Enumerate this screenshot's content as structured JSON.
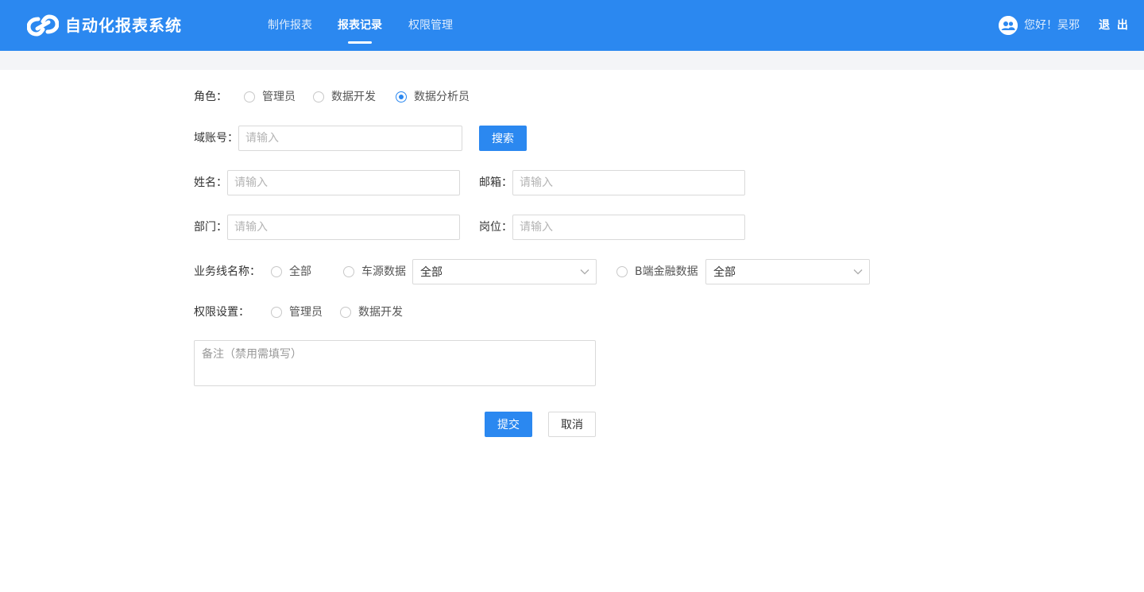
{
  "header": {
    "brand": "自动化报表系统",
    "nav": [
      "制作报表",
      "报表记录",
      "权限管理"
    ],
    "active_nav": "报表记录",
    "greeting": "您好！吴邪",
    "logout": "退 出",
    "color": "#2b88f0"
  },
  "form": {
    "role": {
      "label": "角色：",
      "options": [
        "管理员",
        "数据开发",
        "数据分析员"
      ],
      "selected": "数据分析员"
    },
    "domain_account": {
      "label": "域账号：",
      "placeholder": "请输入",
      "search_button": "搜索"
    },
    "name": {
      "label": "姓名：",
      "placeholder": "请输入"
    },
    "email": {
      "label": "邮箱：",
      "placeholder": "请输入"
    },
    "department": {
      "label": "部门：",
      "placeholder": "请输入"
    },
    "position": {
      "label": "岗位：",
      "placeholder": "请输入"
    },
    "business_line": {
      "label": "业务线名称：",
      "options": [
        "全部",
        "车源数据",
        "B端金融数据"
      ],
      "car_source_select": "全部",
      "b_finance_select": "全部"
    },
    "permission": {
      "label": "权限设置：",
      "options": [
        "管理员",
        "数据开发"
      ]
    },
    "remark": {
      "placeholder": "备注（禁用需填写）"
    },
    "submit": "提交",
    "cancel": "取消"
  }
}
